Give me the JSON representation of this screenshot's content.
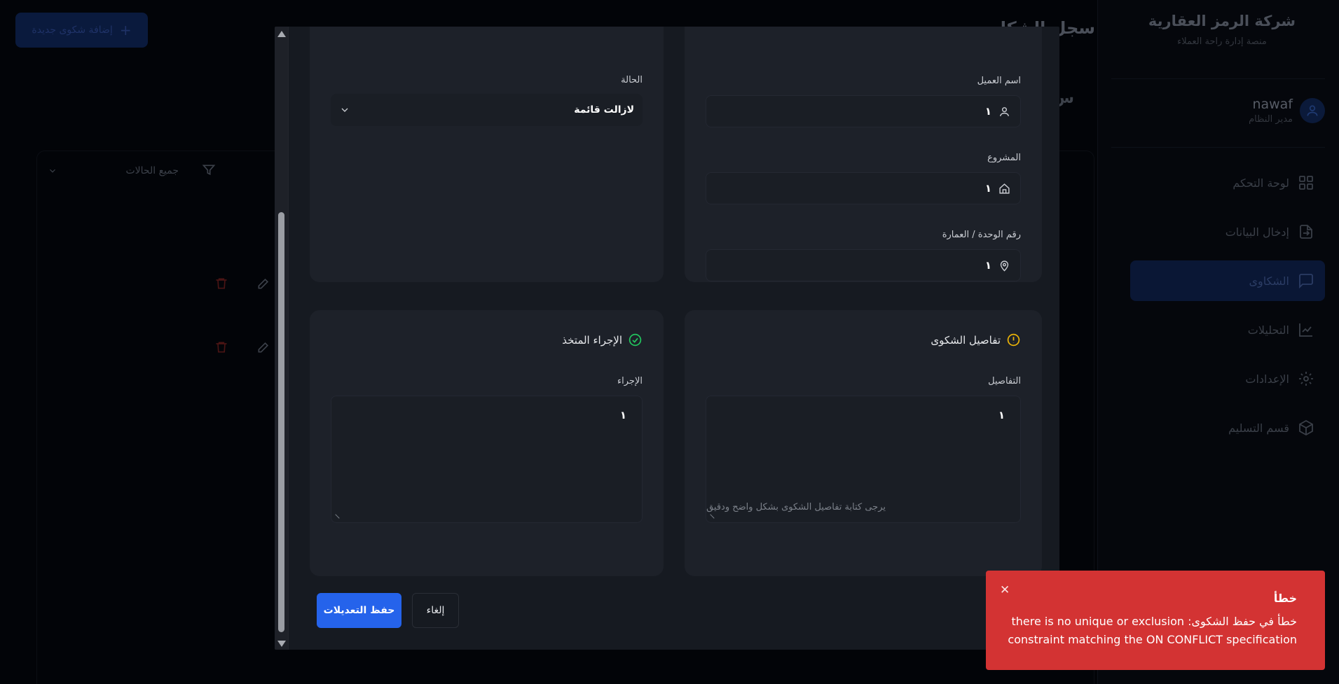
{
  "sidebar": {
    "brand_title": "شركة الرمز العقارية",
    "brand_subtitle": "منصة إدارة راحة العملاء",
    "user_name": "nawaf",
    "user_role": "مدير النظام",
    "items": [
      {
        "label": "لوحة التحكم",
        "icon": "dashboard-icon"
      },
      {
        "label": "إدخال البيانات",
        "icon": "file-import-icon"
      },
      {
        "label": "الشكاوى",
        "icon": "message-icon",
        "active": true
      },
      {
        "label": "التحليلات",
        "icon": "chart-icon"
      },
      {
        "label": "الإعدادات",
        "icon": "gear-icon"
      },
      {
        "label": "قسم التسليم",
        "icon": "package-icon"
      }
    ]
  },
  "main": {
    "title": "سجل الشكا",
    "add_button": "إضافة شكوى جديدة",
    "section_letter": "س",
    "filter_value": "جميع الحالات"
  },
  "modal": {
    "client_card": {
      "client_name_label": "اسم العميل",
      "client_name_value": "١",
      "project_label": "المشروع",
      "project_value": "١",
      "unit_label": "رقم الوحدة / العمارة",
      "unit_value": "١"
    },
    "status_card": {
      "status_label": "الحالة",
      "status_value": "لازالت قائمة"
    },
    "details_card": {
      "title": "تفاصيل الشكوى",
      "details_label": "التفاصيل",
      "details_value": "١",
      "details_hint": "يرجى كتابة تفاصيل الشكوى بشكل واضح ودقيق"
    },
    "action_card": {
      "title": "الإجراء المتخذ",
      "action_label": "الإجراء",
      "action_value": "١"
    },
    "save_button": "حفظ التعديلات",
    "cancel_button": "إلغاء"
  },
  "toast": {
    "title": "خطأ",
    "message": "خطأ في حفظ الشكوى: there is no unique or exclusion constraint matching the ON CONFLICT specification"
  },
  "colors": {
    "primary": "#2563eb",
    "error": "#d33333",
    "warning_icon": "#eab308",
    "success_icon": "#22c55e"
  }
}
